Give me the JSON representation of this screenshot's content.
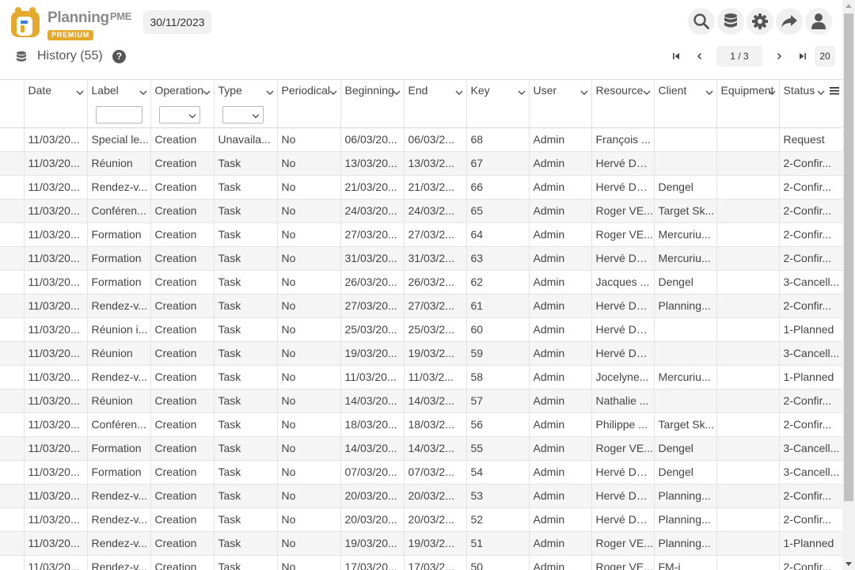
{
  "app": {
    "brand_name": "Planning",
    "brand_suffix": "PME",
    "edition_badge": "PREMIUM",
    "current_date": "30/11/2023",
    "accent_color": "#e4a82b"
  },
  "toolbar": {
    "icons": [
      "search-icon",
      "database-icon",
      "gear-icon",
      "share-icon",
      "user-icon"
    ]
  },
  "history": {
    "title": "History (55)",
    "help_label": "?"
  },
  "pager": {
    "page_current": "1",
    "page_separator": "/",
    "page_total": "3",
    "page_size": "20"
  },
  "table": {
    "columns": [
      "Date",
      "Label",
      "Operation",
      "Type",
      "Periodical",
      "Beginning",
      "End",
      "Key",
      "User",
      "Resource",
      "Client",
      "Equipment",
      "Status"
    ],
    "rows": [
      [
        "11/03/20...",
        "Special le...",
        "Creation",
        "Unavaila...",
        "No",
        "06/03/20...",
        "06/03/2...",
        "68",
        "Admin",
        "François ...",
        "",
        "",
        "Request"
      ],
      [
        "11/03/20...",
        "Réunion",
        "Creation",
        "Task",
        "No",
        "13/03/20...",
        "13/03/2...",
        "67",
        "Admin",
        "Hervé DU...",
        "",
        "",
        "2-Confir..."
      ],
      [
        "11/03/20...",
        "Rendez-v...",
        "Creation",
        "Task",
        "No",
        "21/03/20...",
        "21/03/2...",
        "66",
        "Admin",
        "Hervé DU...",
        "Dengel",
        "",
        "2-Confir..."
      ],
      [
        "11/03/20...",
        "Conféren...",
        "Creation",
        "Task",
        "No",
        "24/03/20...",
        "24/03/2...",
        "65",
        "Admin",
        "Roger VE...",
        "Target Sk...",
        "",
        "2-Confir..."
      ],
      [
        "11/03/20...",
        "Formation",
        "Creation",
        "Task",
        "No",
        "27/03/20...",
        "27/03/2...",
        "64",
        "Admin",
        "Roger VE...",
        "Mercuriu...",
        "",
        "2-Confir..."
      ],
      [
        "11/03/20...",
        "Formation",
        "Creation",
        "Task",
        "No",
        "31/03/20...",
        "31/03/2...",
        "63",
        "Admin",
        "Hervé DU...",
        "Mercuriu...",
        "",
        "2-Confir..."
      ],
      [
        "11/03/20...",
        "Formation",
        "Creation",
        "Task",
        "No",
        "26/03/20...",
        "26/03/2...",
        "62",
        "Admin",
        "Jacques ...",
        "Dengel",
        "",
        "3-Cancell..."
      ],
      [
        "11/03/20...",
        "Rendez-v...",
        "Creation",
        "Task",
        "No",
        "27/03/20...",
        "27/03/2...",
        "61",
        "Admin",
        "Hervé DU...",
        "Planning...",
        "",
        "2-Confir..."
      ],
      [
        "11/03/20...",
        "Réunion i...",
        "Creation",
        "Task",
        "No",
        "25/03/20...",
        "25/03/2...",
        "60",
        "Admin",
        "Hervé DU...",
        "",
        "",
        "1-Planned"
      ],
      [
        "11/03/20...",
        "Réunion",
        "Creation",
        "Task",
        "No",
        "19/03/20...",
        "19/03/2...",
        "59",
        "Admin",
        "Hervé DU...",
        "",
        "",
        "3-Cancell..."
      ],
      [
        "11/03/20...",
        "Rendez-v...",
        "Creation",
        "Task",
        "No",
        "11/03/20...",
        "11/03/2...",
        "58",
        "Admin",
        "Jocelyne...",
        "Mercuriu...",
        "",
        "1-Planned"
      ],
      [
        "11/03/20...",
        "Réunion",
        "Creation",
        "Task",
        "No",
        "14/03/20...",
        "14/03/2...",
        "57",
        "Admin",
        "Nathalie ...",
        "",
        "",
        "2-Confir..."
      ],
      [
        "11/03/20...",
        "Conféren...",
        "Creation",
        "Task",
        "No",
        "18/03/20...",
        "18/03/2...",
        "56",
        "Admin",
        "Philippe ...",
        "Target Sk...",
        "",
        "2-Confir..."
      ],
      [
        "11/03/20...",
        "Formation",
        "Creation",
        "Task",
        "No",
        "14/03/20...",
        "14/03/2...",
        "55",
        "Admin",
        "Roger VE...",
        "Dengel",
        "",
        "3-Cancell..."
      ],
      [
        "11/03/20...",
        "Formation",
        "Creation",
        "Task",
        "No",
        "07/03/20...",
        "07/03/2...",
        "54",
        "Admin",
        "Hervé DU...",
        "Dengel",
        "",
        "3-Cancell..."
      ],
      [
        "11/03/20...",
        "Rendez-v...",
        "Creation",
        "Task",
        "No",
        "20/03/20...",
        "20/03/2...",
        "53",
        "Admin",
        "Hervé DU...",
        "Planning...",
        "",
        "2-Confir..."
      ],
      [
        "11/03/20...",
        "Rendez-v...",
        "Creation",
        "Task",
        "No",
        "20/03/20...",
        "20/03/2...",
        "52",
        "Admin",
        "Hervé DU...",
        "Planning...",
        "",
        "2-Confir..."
      ],
      [
        "11/03/20...",
        "Rendez-v...",
        "Creation",
        "Task",
        "No",
        "19/03/20...",
        "19/03/2...",
        "51",
        "Admin",
        "Roger VE...",
        "Planning...",
        "",
        "1-Planned"
      ],
      [
        "11/03/20...",
        "Rendez-v...",
        "Creation",
        "Task",
        "No",
        "17/03/20...",
        "17/03/2...",
        "50",
        "Admin",
        "Roger VE...",
        "FM-i",
        "",
        "2-Confir..."
      ]
    ]
  }
}
